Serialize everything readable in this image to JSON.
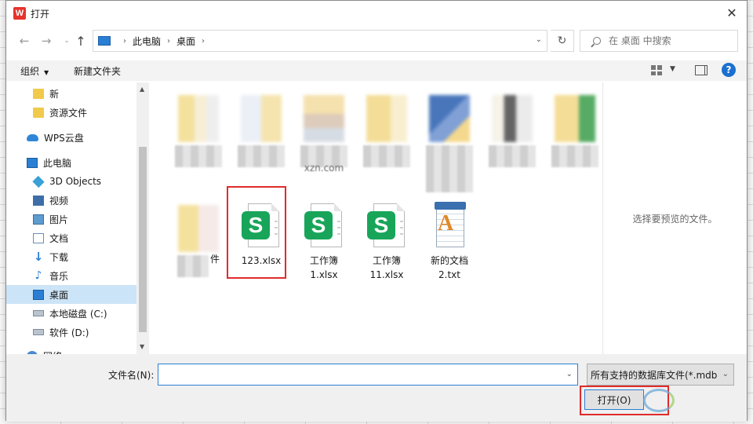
{
  "window": {
    "title": "打开",
    "logo_letter": "W",
    "close_glyph": "✕"
  },
  "nav": {
    "back": "←",
    "forward": "→",
    "recent": "⌄",
    "up": "↑"
  },
  "address": {
    "crumbs": [
      "此电脑",
      "桌面"
    ],
    "separator": "›",
    "dropdown": "⌄",
    "refresh": "↻"
  },
  "search": {
    "placeholder": "在 桌面 中搜索"
  },
  "toolbar": {
    "organize": "组织",
    "new_folder": "新建文件夹",
    "caret": "▼",
    "view_caret": "▼",
    "help": "?"
  },
  "sidebar": {
    "items": [
      {
        "label": "新",
        "icon": "folder-icon"
      },
      {
        "label": "资源文件",
        "icon": "folder-icon"
      },
      {
        "label": "WPS云盘",
        "icon": "cloud-icon"
      },
      {
        "label": "此电脑",
        "icon": "computer-icon"
      },
      {
        "label": "3D Objects",
        "icon": "3d-objects-icon"
      },
      {
        "label": "视频",
        "icon": "video-icon"
      },
      {
        "label": "图片",
        "icon": "pictures-icon"
      },
      {
        "label": "文档",
        "icon": "documents-icon"
      },
      {
        "label": "下载",
        "icon": "download-icon"
      },
      {
        "label": "音乐",
        "icon": "music-icon"
      },
      {
        "label": "桌面",
        "icon": "desktop-icon",
        "selected": true
      },
      {
        "label": "本地磁盘 (C:)",
        "icon": "drive-icon"
      },
      {
        "label": "软件 (D:)",
        "icon": "drive-icon"
      },
      {
        "label": "网络",
        "icon": "network-icon"
      }
    ],
    "scroll_up": "▲",
    "scroll_down": "▼"
  },
  "files": {
    "blurred_caption_fragment": "xzn.com",
    "blurred_row2_suffix": "件",
    "items": [
      {
        "label": "123.xlsx",
        "type": "xlsx",
        "highlighted": true
      },
      {
        "label": "工作簿1.xlsx",
        "line1": "工作簿",
        "line2": "1.xlsx",
        "type": "xlsx"
      },
      {
        "label": "工作簿11.xlsx",
        "line1": "工作簿",
        "line2": "11.xlsx",
        "type": "xlsx"
      },
      {
        "label": "新的文档2.txt",
        "line1": "新的文档",
        "line2": "2.txt",
        "type": "txt"
      }
    ],
    "xlsx_badge": "S",
    "txt_badge": "A"
  },
  "preview": {
    "message": "选择要预览的文件。"
  },
  "bottom": {
    "filename_label": "文件名(N):",
    "filename_value": "",
    "filter_value": "所有支持的数据库文件(*.mdb",
    "dropdown": "⌄",
    "open_label": "打开(O)"
  },
  "colors": {
    "accent": "#2a7fd4",
    "highlight": "#e02b2b",
    "selected": "#cce4f7",
    "xlsx_green": "#18a55a"
  }
}
